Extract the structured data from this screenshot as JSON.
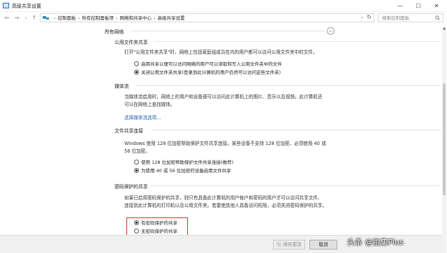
{
  "window": {
    "title": "高级共享设置",
    "controls": [
      "—",
      "☐",
      "✕"
    ]
  },
  "address": {
    "breadcrumb": [
      "控制面板",
      "所有控制面板项",
      "网络和共享中心",
      "高级共享设置"
    ],
    "search_placeholder": "搜索控制面板"
  },
  "content": {
    "group_title": "所有网络",
    "sections": [
      {
        "title": "公用文件夹共享",
        "description": [
          "打开\"公用文件夹共享\"时，网络上包括家庭组成员在内的用户都可以访问公用文件夹中的文件。"
        ],
        "options": [
          {
            "label": "启用共享以便可以访问网络的用户可以读取和写入公用文件夹中的文件",
            "selected": false
          },
          {
            "label": "关闭公用文件夹共享(登录到此计算机的用户仍然可以访问这些文件夹)",
            "selected": true
          }
        ]
      },
      {
        "title": "媒体流",
        "description": [
          "当媒体流启用时，网络上的用户和设备便可以访问此计算机上的图片、音乐以及视频。此计算机还",
          "可以在网络上查找媒体。"
        ],
        "link": "选择媒体流选项..."
      },
      {
        "title": "文件共享连接",
        "description": [
          "Windows 使用 128 位加密帮助保护文件共享连接。某些设备不支持 128 位加密，必须使用 40 或",
          "56 位加密。"
        ],
        "options": [
          {
            "label": "使用 128 位加密帮助保护文件共享连接(推荐)",
            "selected": false
          },
          {
            "label": "为使用 40 或 56 位加密的设备启用文件共享",
            "selected": true
          }
        ]
      },
      {
        "title": "密码保护的共享",
        "description": [
          "如果已启用密码保护的共享，则只有具备此计算机的用户帐户和密码的用户才可以访问共享文件、",
          "连接到此计算机的打印机以及公用文件夹。若要使其他人具备访问权限，必须关闭密码保护的共享。"
        ],
        "options": [
          {
            "label": "有密码保护的共享",
            "selected": true
          },
          {
            "label": "无密码保护的共享",
            "selected": false
          }
        ]
      }
    ]
  },
  "footer": {
    "save_label": "保存更改",
    "cancel_label": "取消"
  },
  "watermark": "头条 @拾集Plus"
}
